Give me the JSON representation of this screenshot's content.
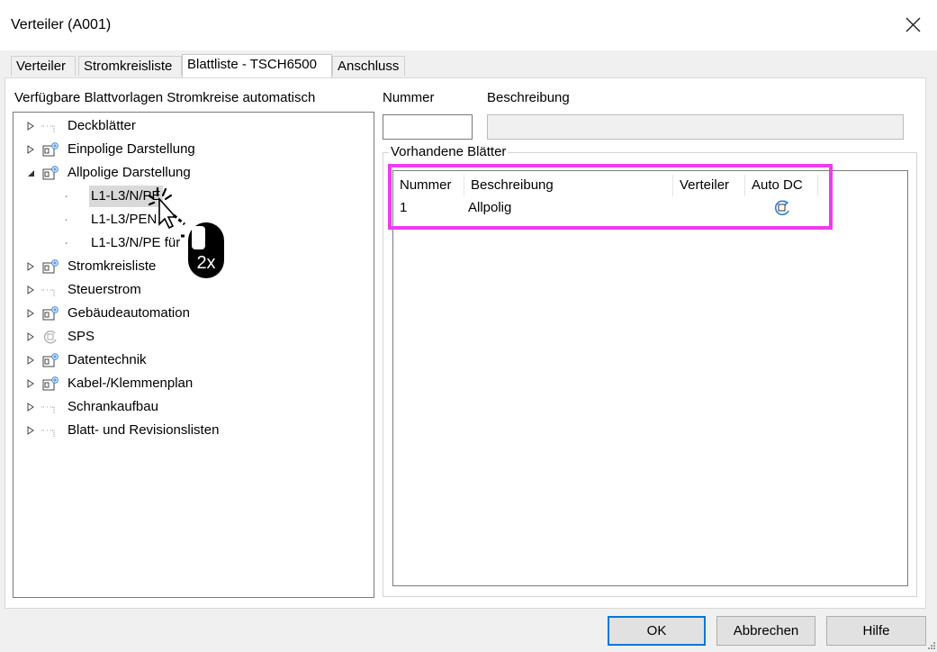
{
  "window": {
    "title": "Verteiler  (A001)"
  },
  "tabs": [
    "Verteiler",
    "Stromkreisliste",
    "Blattliste - TSCH6500",
    "Anschluss"
  ],
  "left": {
    "label": "Verfügbare Blattvorlagen Stromkreise automatisch",
    "tree": [
      {
        "label": "Deckblätter",
        "icon": "dotted-page-icon"
      },
      {
        "label": "Einpolige Darstellung",
        "icon": "module-plus-icon"
      },
      {
        "label": "Allpolige Darstellung",
        "icon": "module-plus-icon",
        "expanded": true,
        "children": [
          "L1-L3/N/PE",
          "L1-L3/PEN",
          "L1-L3/N/PE für"
        ]
      },
      {
        "label": "Stromkreisliste",
        "icon": "module-plus-icon"
      },
      {
        "label": "Steuerstrom",
        "icon": "dotted-page-icon"
      },
      {
        "label": "Gebäudeautomation",
        "icon": "module-plus-icon"
      },
      {
        "label": "SPS",
        "icon": "refresh-icon"
      },
      {
        "label": "Datentechnik",
        "icon": "module-plus-icon"
      },
      {
        "label": "Kabel-/Klemmenplan",
        "icon": "module-plus-icon"
      },
      {
        "label": "Schrankaufbau",
        "icon": "dotted-page-icon"
      },
      {
        "label": "Blatt- und Revisionslisten",
        "icon": "dotted-page-icon"
      }
    ]
  },
  "right": {
    "nummer_label": "Nummer",
    "beschreibung_label": "Beschreibung",
    "nummer_value": "",
    "beschreibung_value": "",
    "group_label": "Vorhandene Blätter",
    "columns": [
      "Nummer",
      "Beschreibung",
      "Verteiler",
      "Auto DC"
    ],
    "rows": [
      {
        "nummer": "1",
        "beschreibung": "Allpolig",
        "verteiler": "",
        "auto_dc_icon": "refresh-icon"
      }
    ]
  },
  "cursor_badge": "2x",
  "buttons": {
    "ok": "OK",
    "cancel": "Abbrechen",
    "help": "Hilfe"
  },
  "colors": {
    "highlight": "#ee3cee",
    "accent": "#0078d7",
    "selection": "#d9d9d9"
  }
}
